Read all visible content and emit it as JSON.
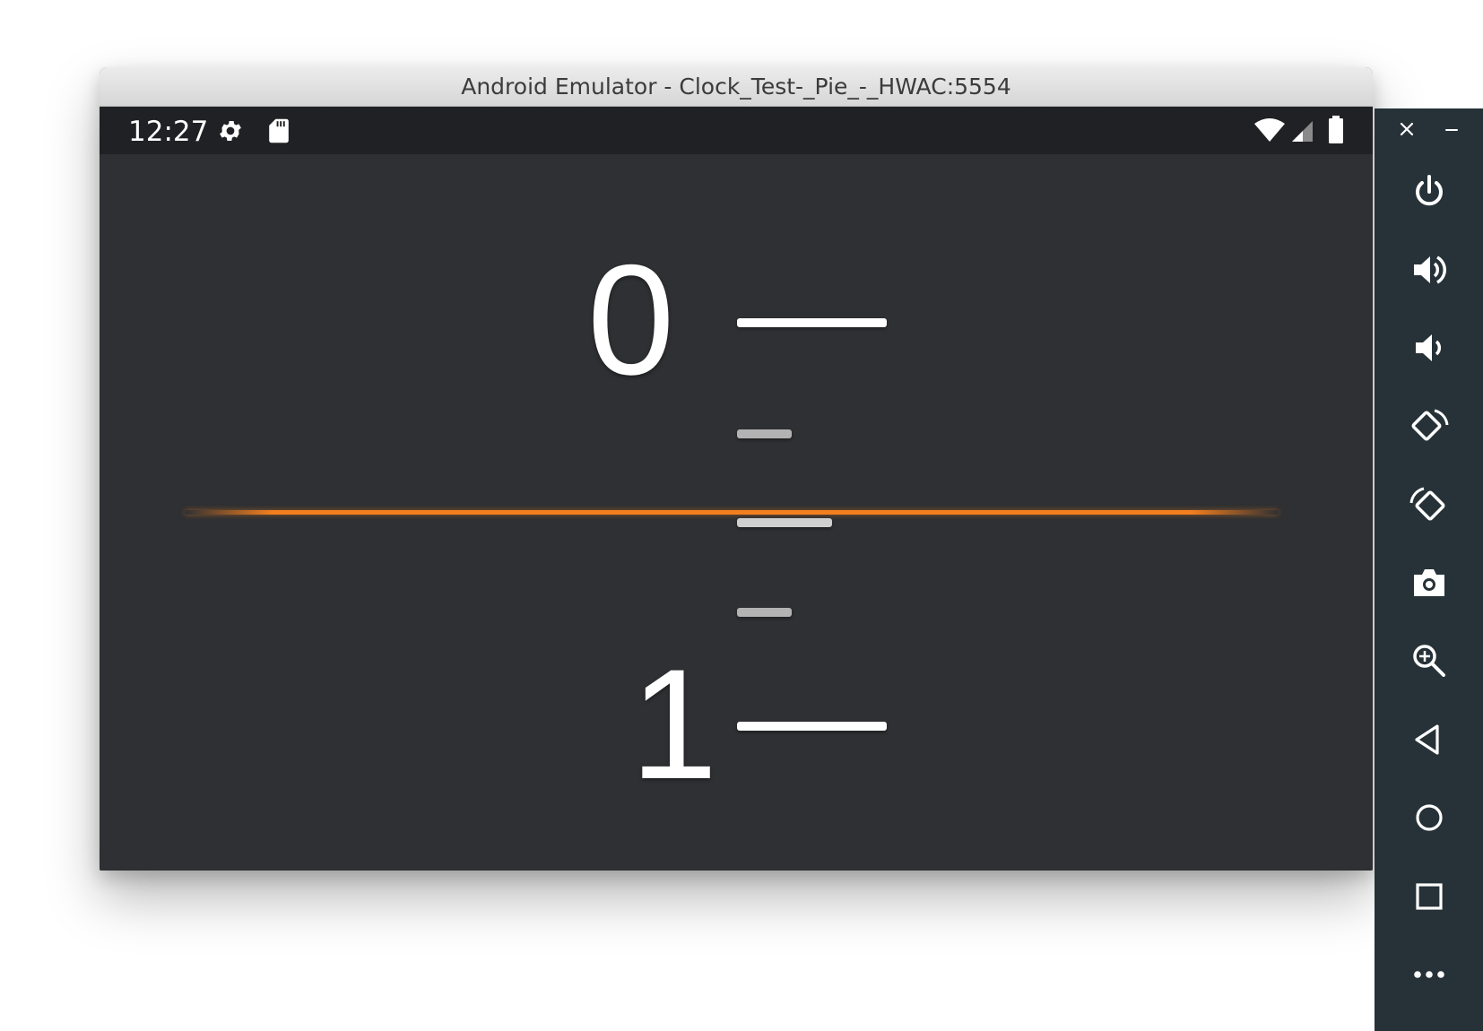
{
  "window": {
    "title": "Android Emulator - Clock_Test-_Pie_-_HWAC:5554"
  },
  "status_bar": {
    "time": "12:27",
    "left_icons": [
      "gear-icon",
      "sd-card-icon"
    ],
    "right_icons": [
      "wifi-icon",
      "signal-icon",
      "battery-icon"
    ]
  },
  "picker": {
    "value_upper": "0",
    "value_lower": "1",
    "accent_color": "#f37f1e"
  },
  "sidebar": {
    "controls": [
      "close-icon",
      "minimize-icon",
      "power-icon",
      "volume-up-icon",
      "volume-down-icon",
      "rotate-left-icon",
      "rotate-right-icon",
      "camera-icon",
      "zoom-icon",
      "back-icon",
      "home-icon",
      "overview-icon",
      "more-icon"
    ]
  }
}
